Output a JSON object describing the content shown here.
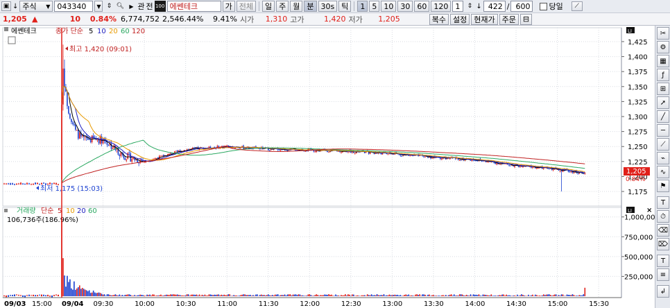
{
  "toolbar1": {
    "market_label": "주식",
    "code": "043340",
    "btn_gwan": "관",
    "btn_jeon": "전",
    "stock_name": "에쎈테크",
    "btn_ga": "가",
    "btn_jeonche": "전체",
    "periods": [
      "일",
      "주",
      "월",
      "분",
      "30s",
      "틱"
    ],
    "intervals": [
      "1",
      "5",
      "10",
      "30",
      "60",
      "120"
    ],
    "interval_input": "1",
    "count_current": "422",
    "count_sep": "/",
    "count_total": "600",
    "today_label": "당일"
  },
  "quote": {
    "price": "1,205",
    "arrow": "▲",
    "change": "10",
    "change_pct": "0.84%",
    "volume": "6,774,752",
    "amount": "2,546.44%",
    "turnover": "9.41%",
    "open_label": "시가",
    "open": "1,310",
    "high_label": "고가",
    "high": "1,420",
    "low_label": "저가",
    "low": "1,205",
    "btn_multi": "복수",
    "btn_settings": "설정",
    "btn_current": "현재가",
    "btn_order": "주문",
    "btn_window": "⊟"
  },
  "price_legend": {
    "name": "에쎈테크",
    "ma_label": "종가 단순",
    "ma_periods": [
      "5",
      "10",
      "20",
      "60",
      "120"
    ],
    "ma_colors": [
      "#000000",
      "#2020c0",
      "#e89a00",
      "#2aa860",
      "#c02020"
    ]
  },
  "volume_legend": {
    "name": "거래량",
    "ma_label": "단순",
    "ma_periods": [
      "5",
      "10",
      "20",
      "60"
    ],
    "ma_colors": [
      "#e0201a",
      "#e89a00",
      "#2020c0",
      "#2aa860"
    ],
    "value": "106,736주(186.96%)"
  },
  "annotations": {
    "high": "최고 1,420 (09:01)",
    "low": "최저 1,175 (15:03)"
  },
  "price_axis": {
    "ticks": [
      "1,425",
      "1,400",
      "1,375",
      "1,350",
      "1,325",
      "1,300",
      "1,275",
      "1,250",
      "1,225",
      "1,200",
      "1,175"
    ],
    "current_price": "1,205",
    "current_pct": "0.84%"
  },
  "volume_axis": {
    "ticks": [
      "1,000,000",
      "750,000",
      "500,000",
      "250,000"
    ]
  },
  "time_axis": {
    "labels": [
      "09/03",
      "15:00",
      "09/04",
      "09:30",
      "10:00",
      "10:30",
      "11:00",
      "11:30",
      "12:00",
      "12:30",
      "13:00",
      "13:30",
      "14:00",
      "14:30",
      "15:00",
      "15:30"
    ]
  },
  "colors": {
    "up": "#e0201a",
    "down": "#1a3fd0",
    "cursor": "#e0201a",
    "panel_bg": "#ffffff"
  },
  "chart_data": {
    "type": "candlestick",
    "symbol": "043340",
    "name": "에쎈테크",
    "interval": "1min",
    "y_range": [
      1160,
      1440
    ],
    "volume_range": [
      0,
      1050000
    ],
    "sessions": [
      {
        "date": "09/03",
        "time_start": "14:40",
        "time_end": "15:30",
        "price_level": 1188
      },
      {
        "date": "09/04",
        "time_start": "09:00",
        "time_end": "15:20"
      }
    ],
    "key_points": [
      {
        "time": "09:00",
        "open": 1195,
        "high": 1330,
        "low": 1190,
        "close": 1320,
        "volume": 1000000
      },
      {
        "time": "09:01",
        "open": 1320,
        "high": 1420,
        "low": 1310,
        "close": 1380,
        "volume": 480000
      },
      {
        "time": "09:02",
        "open": 1380,
        "high": 1395,
        "low": 1335,
        "close": 1350
      },
      {
        "time": "09:05",
        "close": 1310
      },
      {
        "time": "09:10",
        "close": 1275
      },
      {
        "time": "09:15",
        "close": 1262
      },
      {
        "time": "09:30",
        "close": 1262
      },
      {
        "time": "09:45",
        "close": 1235
      },
      {
        "time": "10:00",
        "close": 1225
      },
      {
        "time": "10:30",
        "close": 1245
      },
      {
        "time": "11:00",
        "close": 1250
      },
      {
        "time": "11:30",
        "close": 1246
      },
      {
        "time": "12:00",
        "close": 1244
      },
      {
        "time": "12:30",
        "close": 1242
      },
      {
        "time": "13:00",
        "close": 1238
      },
      {
        "time": "13:30",
        "close": 1232
      },
      {
        "time": "14:00",
        "close": 1228
      },
      {
        "time": "14:30",
        "close": 1218
      },
      {
        "time": "15:00",
        "close": 1212
      },
      {
        "time": "15:03",
        "low": 1175
      },
      {
        "time": "15:20",
        "close": 1205
      }
    ],
    "high": 1420,
    "high_time": "09:01",
    "low": 1175,
    "low_time": "15:03",
    "last": 1205,
    "volume_last": 106736
  }
}
